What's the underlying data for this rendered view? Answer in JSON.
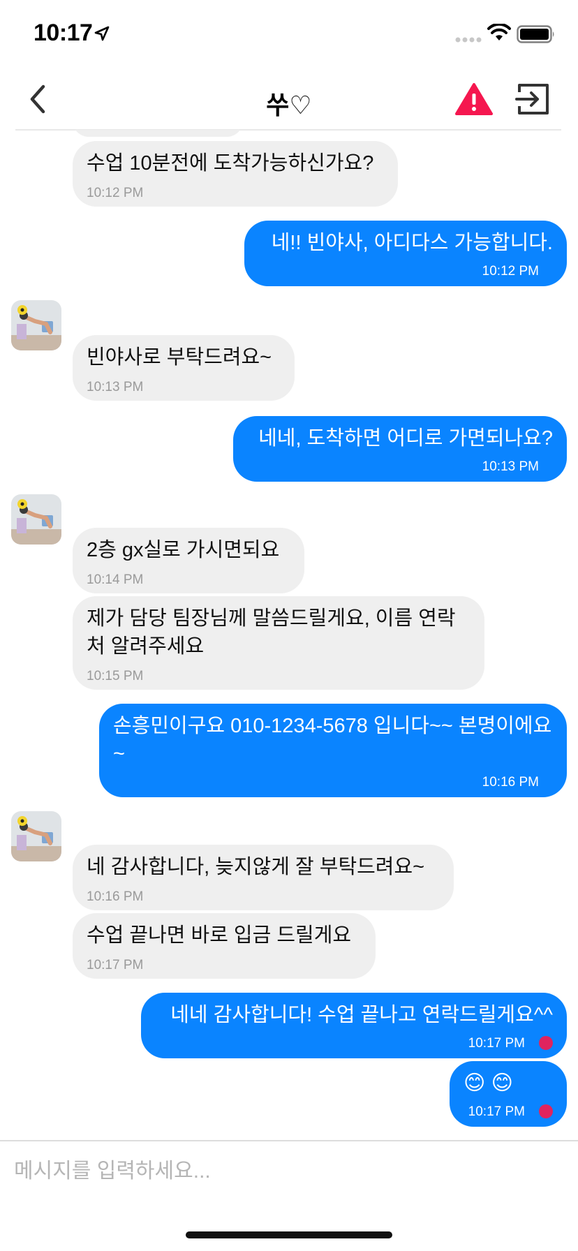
{
  "status_bar": {
    "time": "10:17"
  },
  "header": {
    "title": "쑤♡",
    "back_icon": "chevron-left-icon",
    "report_icon": "warning-triangle-icon",
    "leave_icon": "exit-room-icon",
    "report_color": "#f5174f"
  },
  "colors": {
    "outgoing": "#0a84ff",
    "incoming": "#efefef",
    "unread": "#e0245e"
  },
  "messages": [
    {
      "sender": "other",
      "text": "수업 10분전에 도착가능하신가요?",
      "time": "10:12 PM"
    },
    {
      "sender": "me",
      "text": "네!! 빈야사, 아디다스 가능합니다.",
      "time": "10:12 PM"
    },
    {
      "sender": "other",
      "text": "빈야사로 부탁드려요~",
      "time": "10:13 PM"
    },
    {
      "sender": "me",
      "text": "네네, 도착하면 어디로 가면되나요?",
      "time": "10:13 PM"
    },
    {
      "sender": "other",
      "text": "2층 gx실로 가시면되요",
      "time": "10:14 PM"
    },
    {
      "sender": "other",
      "text": "제가 담당 팀장님께 말씀드릴게요, 이름 연락처 알려주세요",
      "time": "10:15 PM"
    },
    {
      "sender": "me",
      "text": "손흥민이구요 010-1234-5678 입니다~~ 본명이에요~",
      "time": "10:16 PM"
    },
    {
      "sender": "other",
      "text": "네 감사합니다, 늦지않게 잘 부탁드려요~",
      "time": "10:16 PM"
    },
    {
      "sender": "other",
      "text": "수업 끝나면 바로 입금 드릴게요",
      "time": "10:17 PM"
    },
    {
      "sender": "me",
      "text": "네네 감사합니다! 수업 끝나고 연락드릴게요^^",
      "time": "10:17 PM",
      "unread": true
    },
    {
      "sender": "me",
      "text": "😊 😊",
      "time": "10:17 PM",
      "unread": true
    }
  ],
  "composer": {
    "placeholder": "메시지를 입력하세요..."
  }
}
